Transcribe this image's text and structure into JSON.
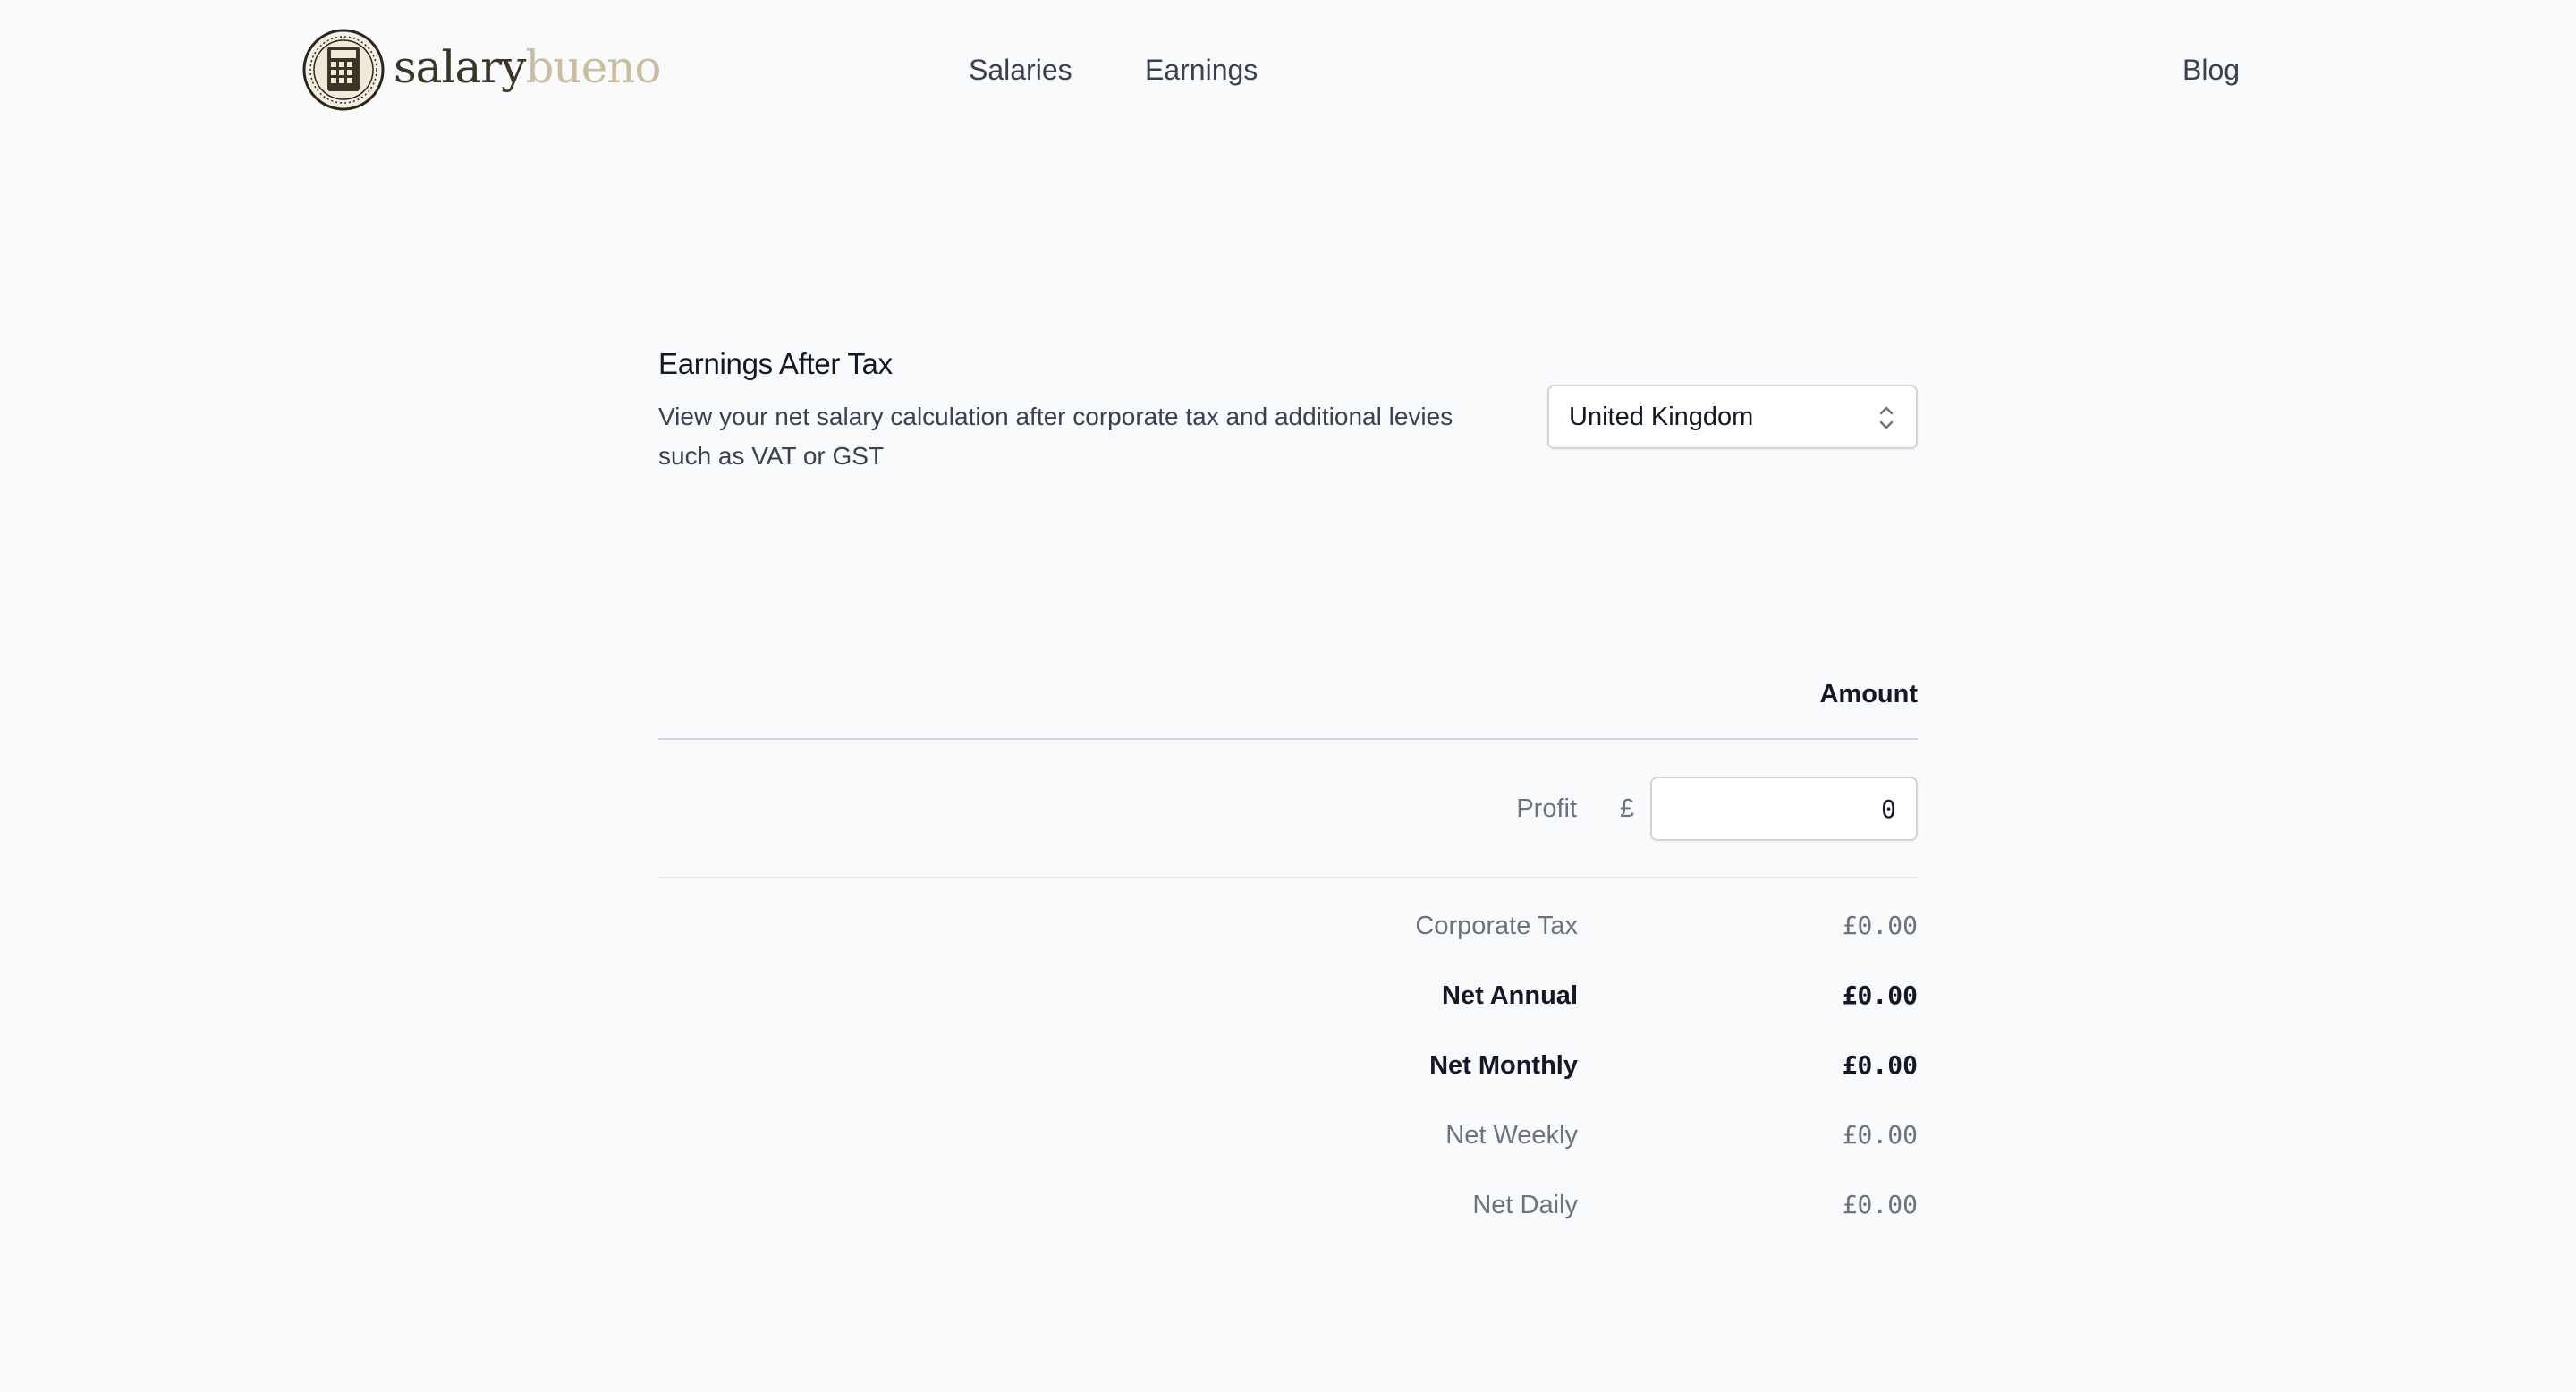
{
  "brand": {
    "name_part1": "salary",
    "name_part2": "bueno",
    "logo_icon": "calculator-seal-icon",
    "colors": {
      "dark": "#3b3427",
      "light": "#cbbd9e"
    }
  },
  "nav": {
    "salaries": "Salaries",
    "earnings": "Earnings",
    "blog": "Blog"
  },
  "intro": {
    "title": "Earnings After Tax",
    "description": "View your net salary calculation after corporate tax and additional levies such as VAT or GST"
  },
  "country_select": {
    "value": "United Kingdom",
    "icon": "chevron-up-down-icon"
  },
  "table": {
    "amount_header": "Amount",
    "profit_label": "Profit",
    "currency_symbol": "£",
    "profit_value": "0",
    "rows": [
      {
        "label": "Corporate Tax",
        "value": "£0.00"
      },
      {
        "label": "Net Annual",
        "value": "£0.00"
      },
      {
        "label": "Net Monthly",
        "value": "£0.00"
      },
      {
        "label": "Net Weekly",
        "value": "£0.00"
      },
      {
        "label": "Net Daily",
        "value": "£0.00"
      }
    ]
  },
  "colors": {
    "background": "#f8fafc",
    "text_primary": "#111827",
    "text_muted": "#6b7280",
    "border": "#d1d5db"
  }
}
